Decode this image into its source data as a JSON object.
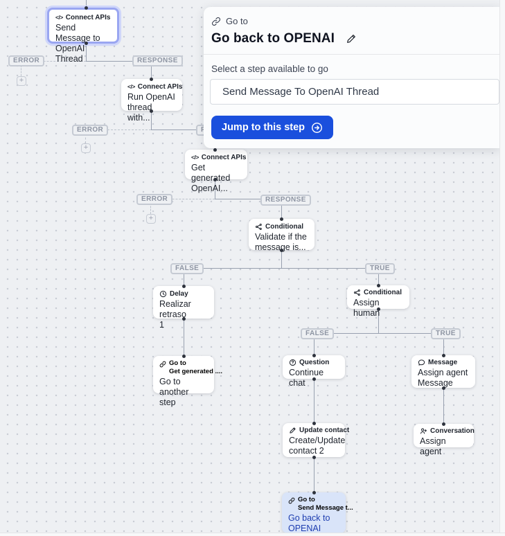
{
  "panel": {
    "type_label": "Go to",
    "title": "Go back to OPENAI",
    "select_label": "Select a step available to go",
    "select_value": "Send Message To OpenAI Thread",
    "jump_button_label": "Jump to this step"
  },
  "badges": {
    "error": "ERROR",
    "response": "RESPONSE",
    "false_label": "FALSE",
    "true_label": "TRUE",
    "plus": "+"
  },
  "icons": {
    "code_glyph": "</>",
    "panel_type_icon": "link-icon",
    "edit_icon": "pencil-icon",
    "button_icon": "arrow-right-circle-icon"
  },
  "nodes": {
    "send_message": {
      "icon": "code-icon",
      "type_label": "Connect APIs",
      "body": "Send Message to\nOpenAI Thread"
    },
    "run_openai": {
      "icon": "code-icon",
      "type_label": "Connect APIs",
      "body": "Run OpenAI\nthread with..."
    },
    "get_generated": {
      "icon": "code-icon",
      "type_label": "Connect APIs",
      "body": "Get generated\nOpenAI..."
    },
    "validate": {
      "icon": "conditional-icon",
      "type_label": "Conditional",
      "body": "Validate if the\nmessage is..."
    },
    "delay": {
      "icon": "clock-icon",
      "type_label": "Delay",
      "body": "Realizar retraso\n1"
    },
    "goto_another": {
      "icon": "link-icon",
      "type_label": "Go to",
      "target_label": "Get generated ....",
      "body": "Go to another\nstep"
    },
    "assign_human": {
      "icon": "conditional-icon",
      "type_label": "Conditional",
      "body": "Assign human"
    },
    "question": {
      "icon": "question-icon",
      "type_label": "Question",
      "body": "Continue chat"
    },
    "message": {
      "icon": "message-icon",
      "type_label": "Message",
      "body": "Assign agent\nMessage"
    },
    "update_contact": {
      "icon": "pencil-icon",
      "type_label": "Update contact",
      "body": "Create/Update\ncontact 2"
    },
    "conversation": {
      "icon": "person-add-icon",
      "type_label": "Conversation",
      "body": "Assign agent"
    },
    "go_back": {
      "icon": "link-icon",
      "type_label": "Go to",
      "target_label": "Send Message t...",
      "body": "Go back to\nOPENAI"
    }
  },
  "colors": {
    "primary_blue": "#1a4fdd",
    "selected_node_border": "#9aa6f1",
    "goto_highlight_bg": "#d9e4f9",
    "goto_highlight_text": "#1d3db0",
    "canvas_bg": "#eef0f3"
  }
}
